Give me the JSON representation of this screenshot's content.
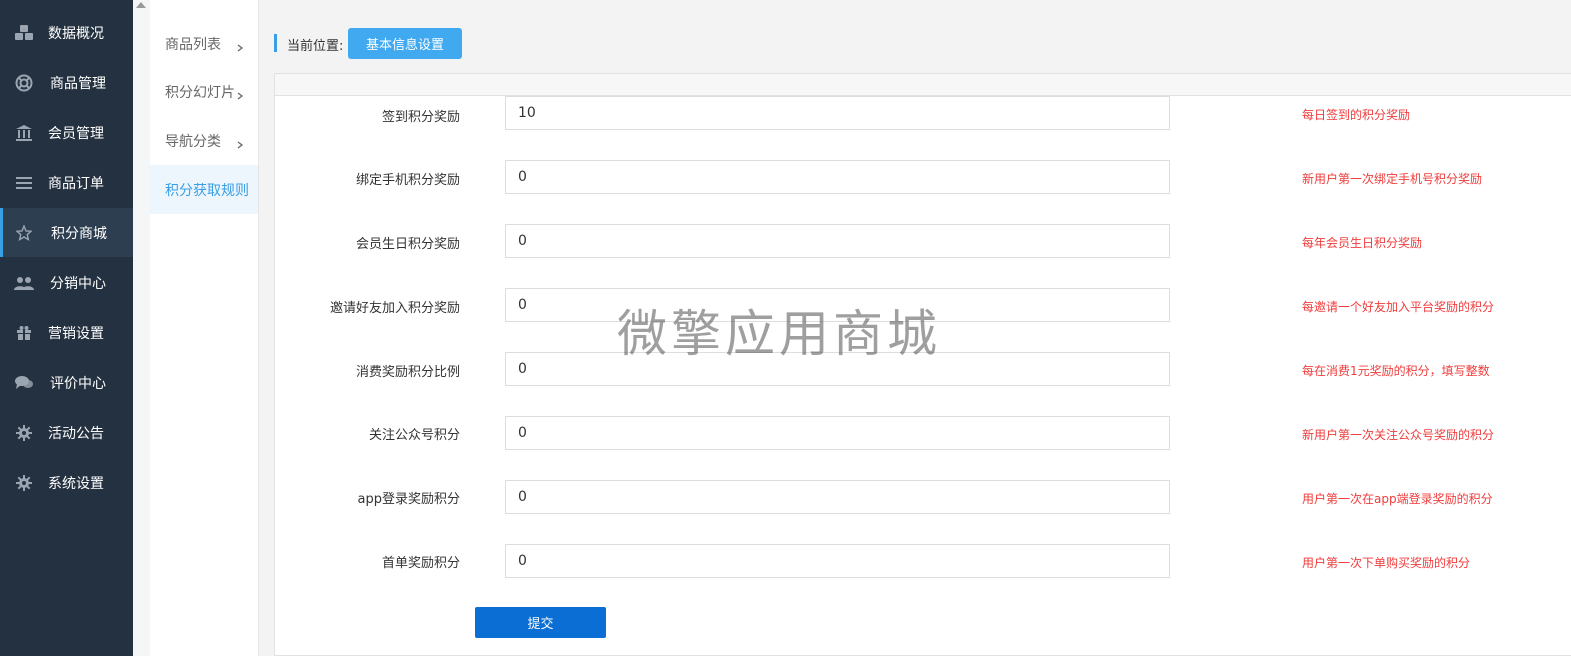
{
  "sidebar": {
    "items": [
      {
        "label": "数据概况",
        "icon": "cubes-icon"
      },
      {
        "label": "商品管理",
        "icon": "lifebuoy-icon"
      },
      {
        "label": "会员管理",
        "icon": "bank-icon"
      },
      {
        "label": "商品订单",
        "icon": "list-icon"
      },
      {
        "label": "积分商城",
        "icon": "star-icon"
      },
      {
        "label": "分销中心",
        "icon": "users-icon"
      },
      {
        "label": "营销设置",
        "icon": "gift-icon"
      },
      {
        "label": "评价中心",
        "icon": "comments-icon"
      },
      {
        "label": "活动公告",
        "icon": "gear-icon"
      },
      {
        "label": "系统设置",
        "icon": "gear-icon"
      }
    ],
    "active_index": 4
  },
  "subnav": {
    "items": [
      {
        "label": "商品列表"
      },
      {
        "label": "积分幻灯片"
      },
      {
        "label": "导航分类"
      },
      {
        "label": "积分获取规则"
      }
    ],
    "active_index": 3
  },
  "breadcrumb": {
    "label": "当前位置:",
    "current": "基本信息设置"
  },
  "form": {
    "rows": [
      {
        "label": "签到积分奖励",
        "value": "10",
        "hint": "每日签到的积分奖励"
      },
      {
        "label": "绑定手机积分奖励",
        "value": "0",
        "hint": "新用户第一次绑定手机号积分奖励"
      },
      {
        "label": "会员生日积分奖励",
        "value": "0",
        "hint": "每年会员生日积分奖励"
      },
      {
        "label": "邀请好友加入积分奖励",
        "value": "0",
        "hint": "每邀请一个好友加入平台奖励的积分"
      },
      {
        "label": "消费奖励积分比例",
        "value": "0",
        "hint": "每在消费1元奖励的积分，填写整数"
      },
      {
        "label": "关注公众号积分",
        "value": "0",
        "hint": "新用户第一次关注公众号奖励的积分"
      },
      {
        "label": "app登录奖励积分",
        "value": "0",
        "hint": "用户第一次在app端登录奖励的积分"
      },
      {
        "label": "首单奖励积分",
        "value": "0",
        "hint": "用户第一次下单购买奖励的积分"
      }
    ],
    "submit_label": "提交"
  },
  "watermark": "微擎应用商城",
  "colors": {
    "sidebar_bg": "#243140",
    "accent": "#3a9ee4",
    "hint_red": "#f03c3c",
    "submit_blue": "#0b6ed5"
  }
}
